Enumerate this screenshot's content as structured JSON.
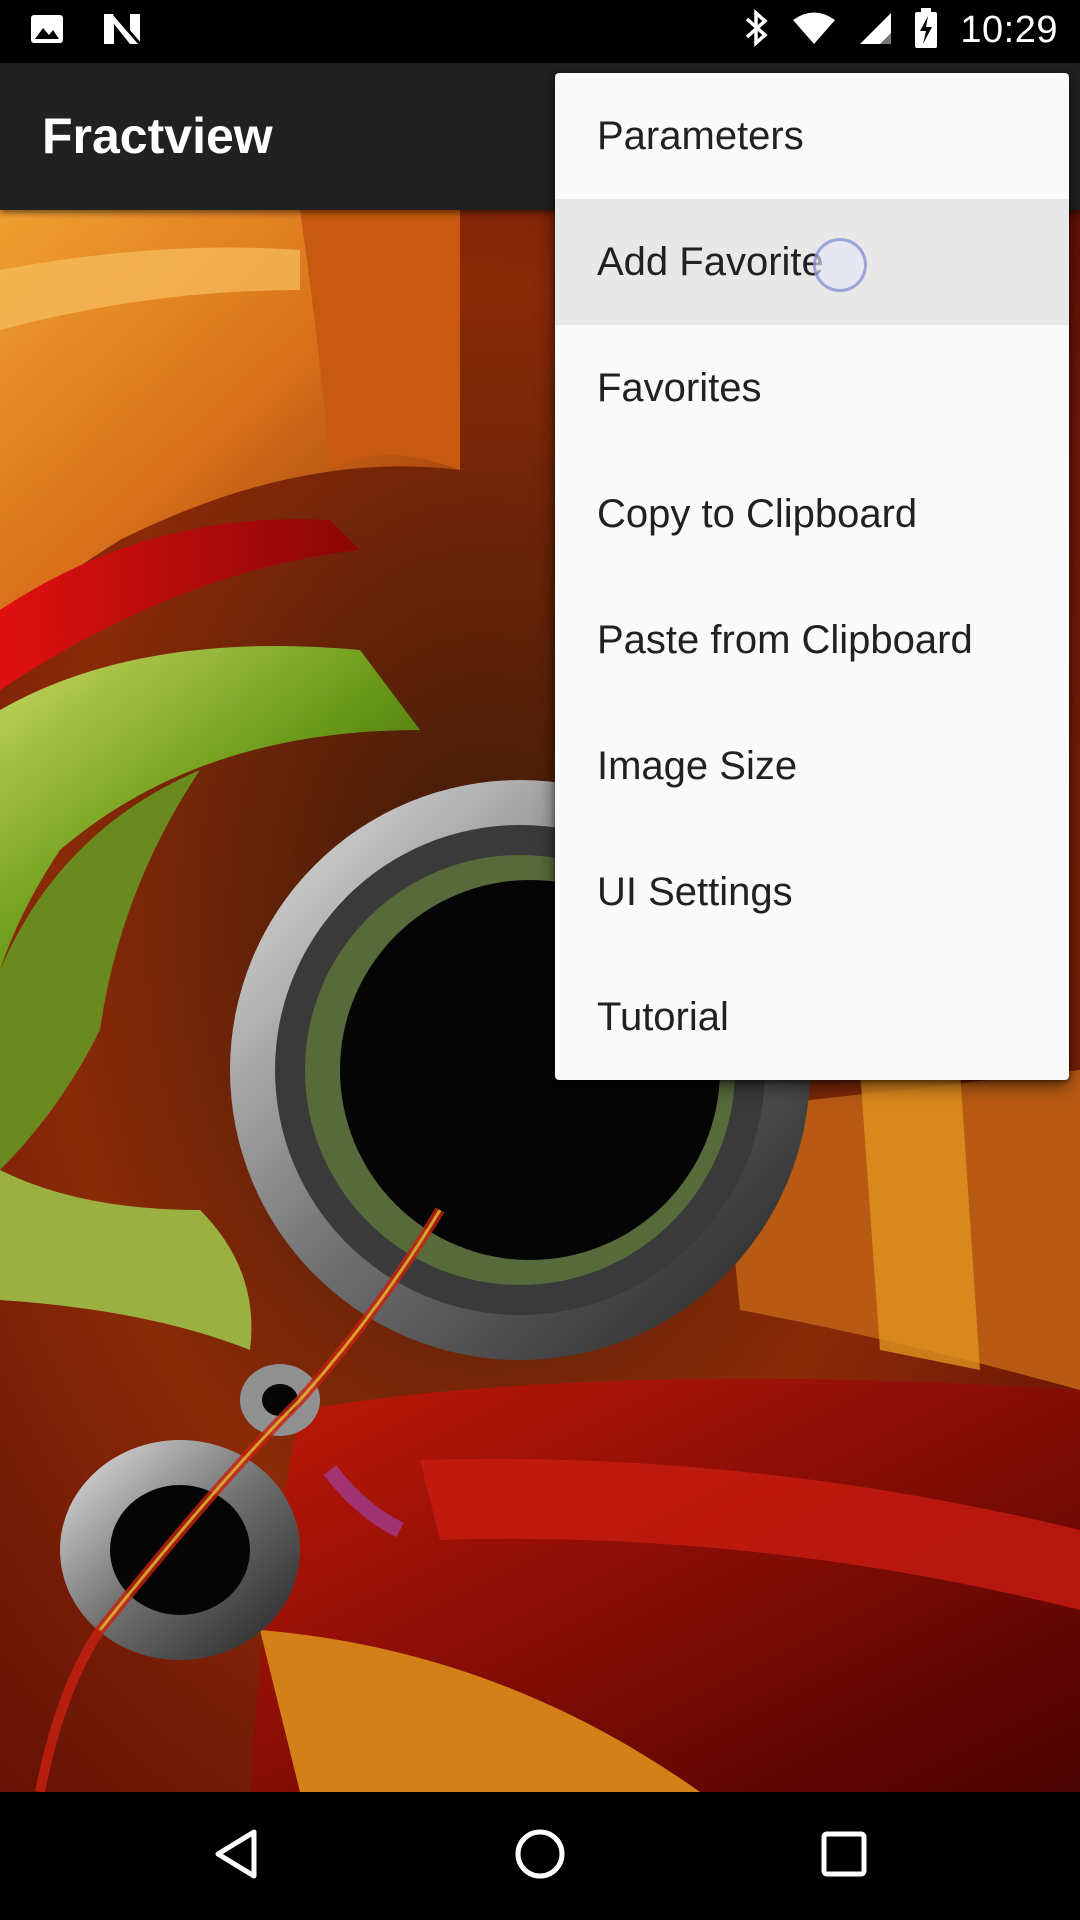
{
  "status_bar": {
    "time": "10:29",
    "icons": [
      "image-notification-icon",
      "n-notification-icon",
      "bluetooth-icon",
      "wifi-icon",
      "signal-icon",
      "battery-charging-icon"
    ]
  },
  "app_bar": {
    "title": "Fractview"
  },
  "menu": {
    "items": [
      {
        "label": "Parameters"
      },
      {
        "label": "Add Favorite",
        "pressed": true
      },
      {
        "label": "Favorites"
      },
      {
        "label": "Copy to Clipboard"
      },
      {
        "label": "Paste from Clipboard"
      },
      {
        "label": "Image Size"
      },
      {
        "label": "UI Settings"
      },
      {
        "label": "Tutorial"
      }
    ]
  },
  "nav_bar": {
    "buttons": [
      "back-icon",
      "home-icon",
      "recents-icon"
    ]
  },
  "colors": {
    "app_bar": "#212121",
    "menu_bg": "#fafafa",
    "menu_pressed": "#e8e8e8"
  }
}
